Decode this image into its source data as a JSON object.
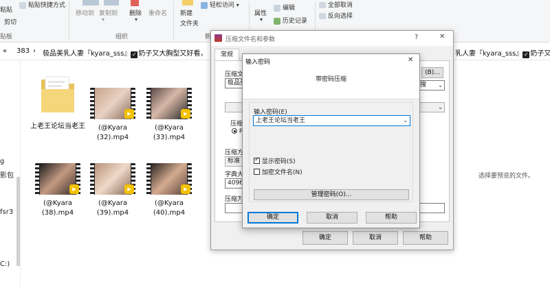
{
  "ribbon": {
    "paste": "粘贴",
    "paste_shortcut": "粘贴快捷方式",
    "cut": "剪切",
    "move_to": "移动到",
    "copy_to": "复制到",
    "delete": "删除",
    "rename": "重命名",
    "new_folder_1": "新建",
    "new_folder_2": "文件夹",
    "easy_access": "轻松访问",
    "properties": "属性",
    "edit": "编辑",
    "history": "历史记录",
    "select_none": "全部取消",
    "invert_select": "反向选择",
    "group_clipboard": "贴板",
    "group_organize": "组织",
    "group_new": "新"
  },
  "address": {
    "arrows": "«",
    "seg1": "383",
    "sep": "›",
    "seg2_a": "极品美乳人妻『kyara_sss』",
    "seg2_b": "奶子又大胸型又好看，",
    "right_a": "乳人妻『kyara_sss』",
    "right_b": "奶子又大"
  },
  "nav": {
    "items": [
      "g",
      "影包",
      "fsr3",
      "C:)"
    ]
  },
  "files": [
    {
      "name": "上老王论坛当老王",
      "kind": "folder"
    },
    {
      "name": "(@Kyara\n(32).mp4",
      "kind": "video"
    },
    {
      "name": "(@Kyara\n(33).mp4",
      "kind": "video"
    },
    {
      "name": "(@Kyara\n(38).mp4",
      "kind": "video"
    },
    {
      "name": "(@Kyara\n(39).mp4",
      "kind": "video"
    },
    {
      "name": "(@Kyara\n(40).mp4",
      "kind": "video"
    }
  ],
  "badge_label": "Player",
  "preview_hint": "选择要预览的文件。",
  "archive_dialog": {
    "title": "压缩文件名和参数",
    "help_glyph": "?",
    "close_glyph": "✕",
    "tab_general": "常规",
    "label_archive_name": "压缩文",
    "archive_name_value": "极品美",
    "browse": "(B)...",
    "label_update": "搜",
    "label_format": "压缩",
    "format_value": "RA",
    "label_method": "压缩方",
    "method_value": "标准",
    "label_dict": "字典大",
    "dict_value": "4096",
    "label_split": "压缩为",
    "ok": "确定",
    "cancel": "取消",
    "help": "帮助"
  },
  "password_dialog": {
    "title": "输入密码",
    "close_glyph": "✕",
    "header": "带密码压缩",
    "label_password": "输入密码(E)",
    "password_value": "上老王论坛当老王",
    "show_password": "显示密码(S)",
    "encrypt_names": "加密文件名(N)",
    "show_password_checked": true,
    "encrypt_names_checked": false,
    "manage": "管理密码(O)...",
    "ok": "确定",
    "cancel": "取消",
    "help": "帮助"
  },
  "colors": {
    "accent": "#0078d7",
    "badge": "#f2c100",
    "folder": "#f5d67a"
  }
}
